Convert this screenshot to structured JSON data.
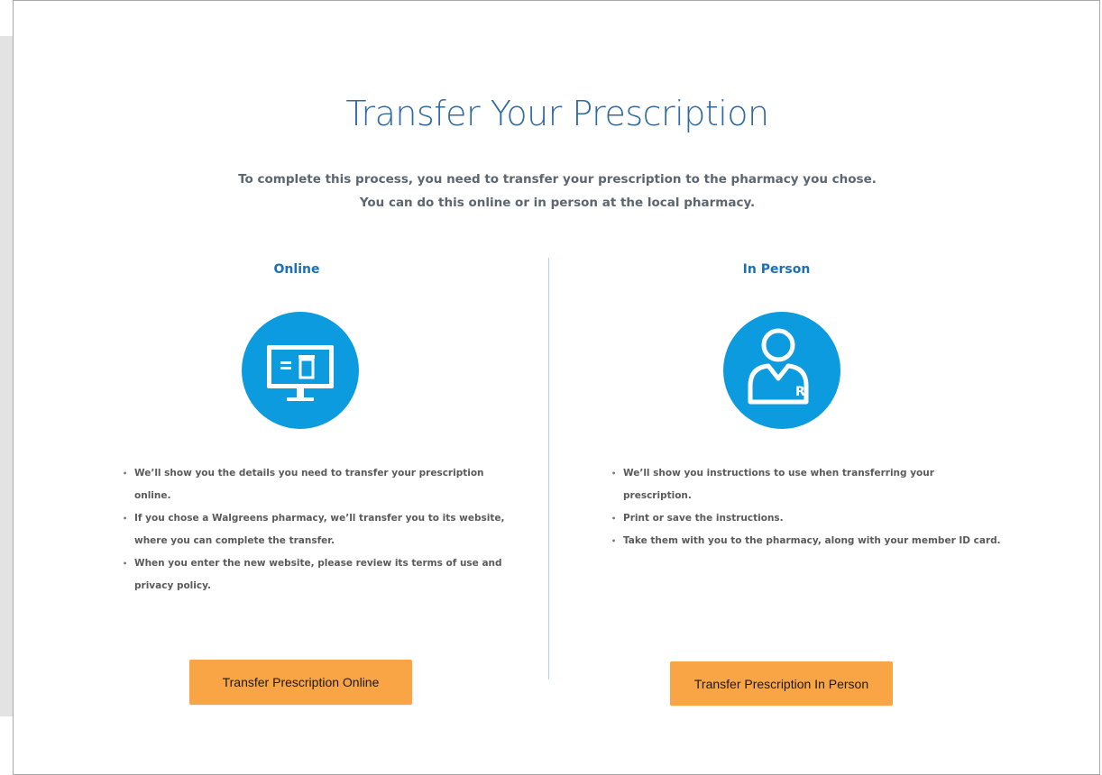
{
  "page": {
    "title": "Transfer Your Prescription",
    "subtitle_line1": "To complete this process, you need to transfer your prescription to the pharmacy you chose.",
    "subtitle_line2": "You can do this online or in person at the local pharmacy."
  },
  "online": {
    "heading": "Online",
    "icon": "computer-prescription-icon",
    "bullets": [
      "We’ll show you the details you need to transfer your prescription online.",
      "If you chose a Walgreens pharmacy, we’ll transfer you to its website, where you can complete the transfer.",
      "When you enter the new website, please review its terms of use and privacy policy."
    ],
    "button_label": "Transfer Prescription Online"
  },
  "in_person": {
    "heading": "In Person",
    "icon": "pharmacist-rx-icon",
    "bullets": [
      "We’ll show you instructions to use when transferring your prescription.",
      "Print or save the instructions.",
      "Take them with you to the pharmacy, along with your member ID card."
    ],
    "button_label": "Transfer Prescription In Person"
  },
  "colors": {
    "title": "#2f6aa0",
    "heading": "#1d70b8",
    "icon_circle": "#0d9be0",
    "button": "#f9a546",
    "divider": "#aed3ec"
  }
}
